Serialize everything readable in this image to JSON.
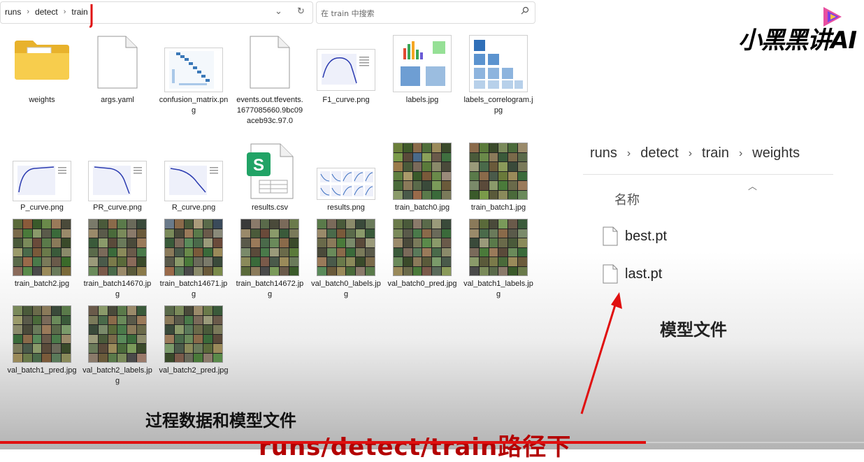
{
  "address_bar": {
    "crumbs": [
      "runs",
      "detect",
      "train"
    ],
    "search_placeholder": "在 train 中搜索"
  },
  "files": [
    {
      "label": "weights"
    },
    {
      "label": "args.yaml"
    },
    {
      "label": "confusion_matrix.png"
    },
    {
      "label": "events.out.tfevents.1677085660.9bc09aceb93c.97.0"
    },
    {
      "label": "F1_curve.png"
    },
    {
      "label": "labels.jpg"
    },
    {
      "label": "labels_correlogram.jpg"
    },
    {
      "label": "P_curve.png"
    },
    {
      "label": "PR_curve.png"
    },
    {
      "label": "R_curve.png"
    },
    {
      "label": "results.csv"
    },
    {
      "label": "results.png"
    },
    {
      "label": "train_batch0.jpg"
    },
    {
      "label": "train_batch1.jpg"
    },
    {
      "label": "train_batch2.jpg"
    },
    {
      "label": "train_batch14670.jpg"
    },
    {
      "label": "train_batch14671.jpg"
    },
    {
      "label": "train_batch14672.jpg"
    },
    {
      "label": "val_batch0_labels.jpg"
    },
    {
      "label": "val_batch0_pred.jpg"
    },
    {
      "label": "val_batch1_labels.jpg"
    },
    {
      "label": "val_batch1_pred.jpg"
    },
    {
      "label": "val_batch2_labels.jpg"
    },
    {
      "label": "val_batch2_pred.jpg"
    }
  ],
  "right_panel": {
    "crumbs": [
      "runs",
      "detect",
      "train",
      "weights"
    ],
    "column_header": "名称",
    "files": [
      "best.pt",
      "last.pt"
    ]
  },
  "captions": {
    "model_files": "模型文件",
    "process_data": "过程数据和模型文件",
    "path": "runs/detect/train路径下"
  },
  "logo": {
    "text": "小黑黑讲AI"
  },
  "colors": {
    "folder": "#f5c842",
    "csv_green": "#21a366",
    "annotation_red": "#e01010"
  }
}
